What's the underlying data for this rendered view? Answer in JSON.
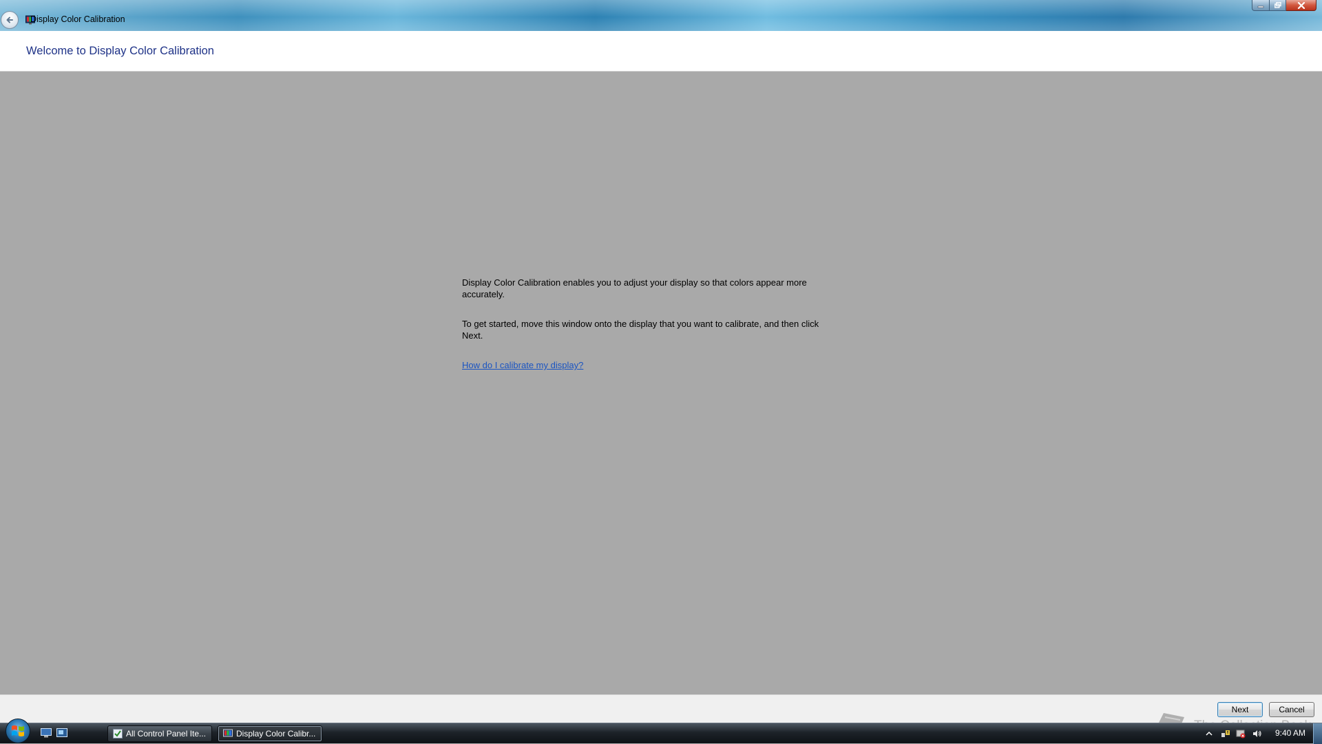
{
  "window": {
    "title": "Display Color Calibration",
    "controls": {
      "minimize_icon": "minimize-icon",
      "maximize_icon": "restore-icon",
      "close_icon": "close-icon"
    }
  },
  "header": {
    "title": "Welcome to Display Color Calibration"
  },
  "content": {
    "paragraph1": "Display Color Calibration enables you to adjust your display so that colors appear more accurately.",
    "paragraph2": "To get started, move this window onto the display that you want to calibrate, and then click Next.",
    "help_link": "How do I calibrate my display?"
  },
  "footer": {
    "next_label": "Next",
    "cancel_label": "Cancel"
  },
  "taskbar": {
    "tasks": [
      {
        "label": "All Control Panel Ite...",
        "icon": "control-panel-icon",
        "active": false
      },
      {
        "label": "Display Color Calibr...",
        "icon": "display-calibration-icon",
        "active": true
      }
    ],
    "clock": "9:40 AM",
    "tray_icons": [
      "show-hidden-icons-icon",
      "network-icon",
      "action-center-icon",
      "volume-icon"
    ]
  },
  "watermark": {
    "text": "The Collection Book"
  },
  "colors": {
    "content_background": "#a9a9a9",
    "title_color": "#1e3287",
    "link_color": "#1a54c2"
  }
}
